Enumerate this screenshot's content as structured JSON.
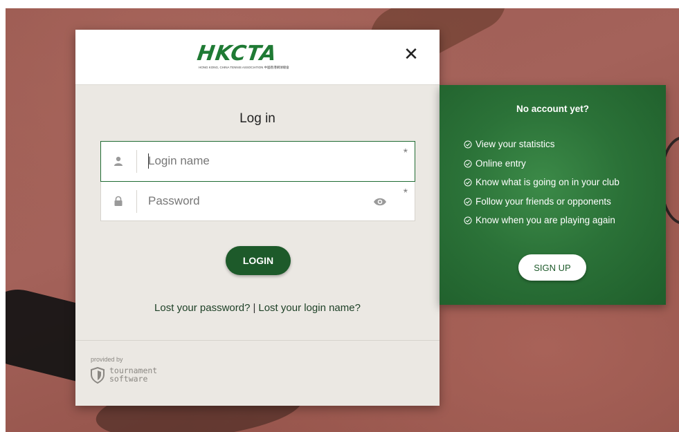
{
  "header": {
    "logo_text": "HKCTA",
    "logo_subtitle": "HONG KONG, CHINA TENNIS ASSOCIATION 中國香港網球總會",
    "close_label": "✕"
  },
  "login": {
    "title": "Log in",
    "login_name_placeholder": "Login name",
    "password_placeholder": "Password",
    "required_marker": "*",
    "submit_label": "LOGIN",
    "lost_password": "Lost your password?",
    "separator": "|",
    "lost_login_name": "Lost your login name?"
  },
  "footer": {
    "provided_by": "provided by",
    "brand_line1": "tournament",
    "brand_line2": "software"
  },
  "signup": {
    "title": "No account yet?",
    "benefits": [
      "View your statistics",
      "Online entry",
      "Know what is going on in your club",
      "Follow your friends or opponents",
      "Know when you are playing again"
    ],
    "button_label": "SIGN UP"
  },
  "colors": {
    "brand_green": "#1d5a2a",
    "panel_green": "#2b7238",
    "modal_bg": "#ebe8e3",
    "court_clay": "#9c5b52"
  },
  "icons": {
    "login_name": "user-icon",
    "password": "lock-icon",
    "show_password": "eye-icon",
    "benefit": "check-circle-icon",
    "close": "close-icon",
    "provider": "shield-icon"
  }
}
